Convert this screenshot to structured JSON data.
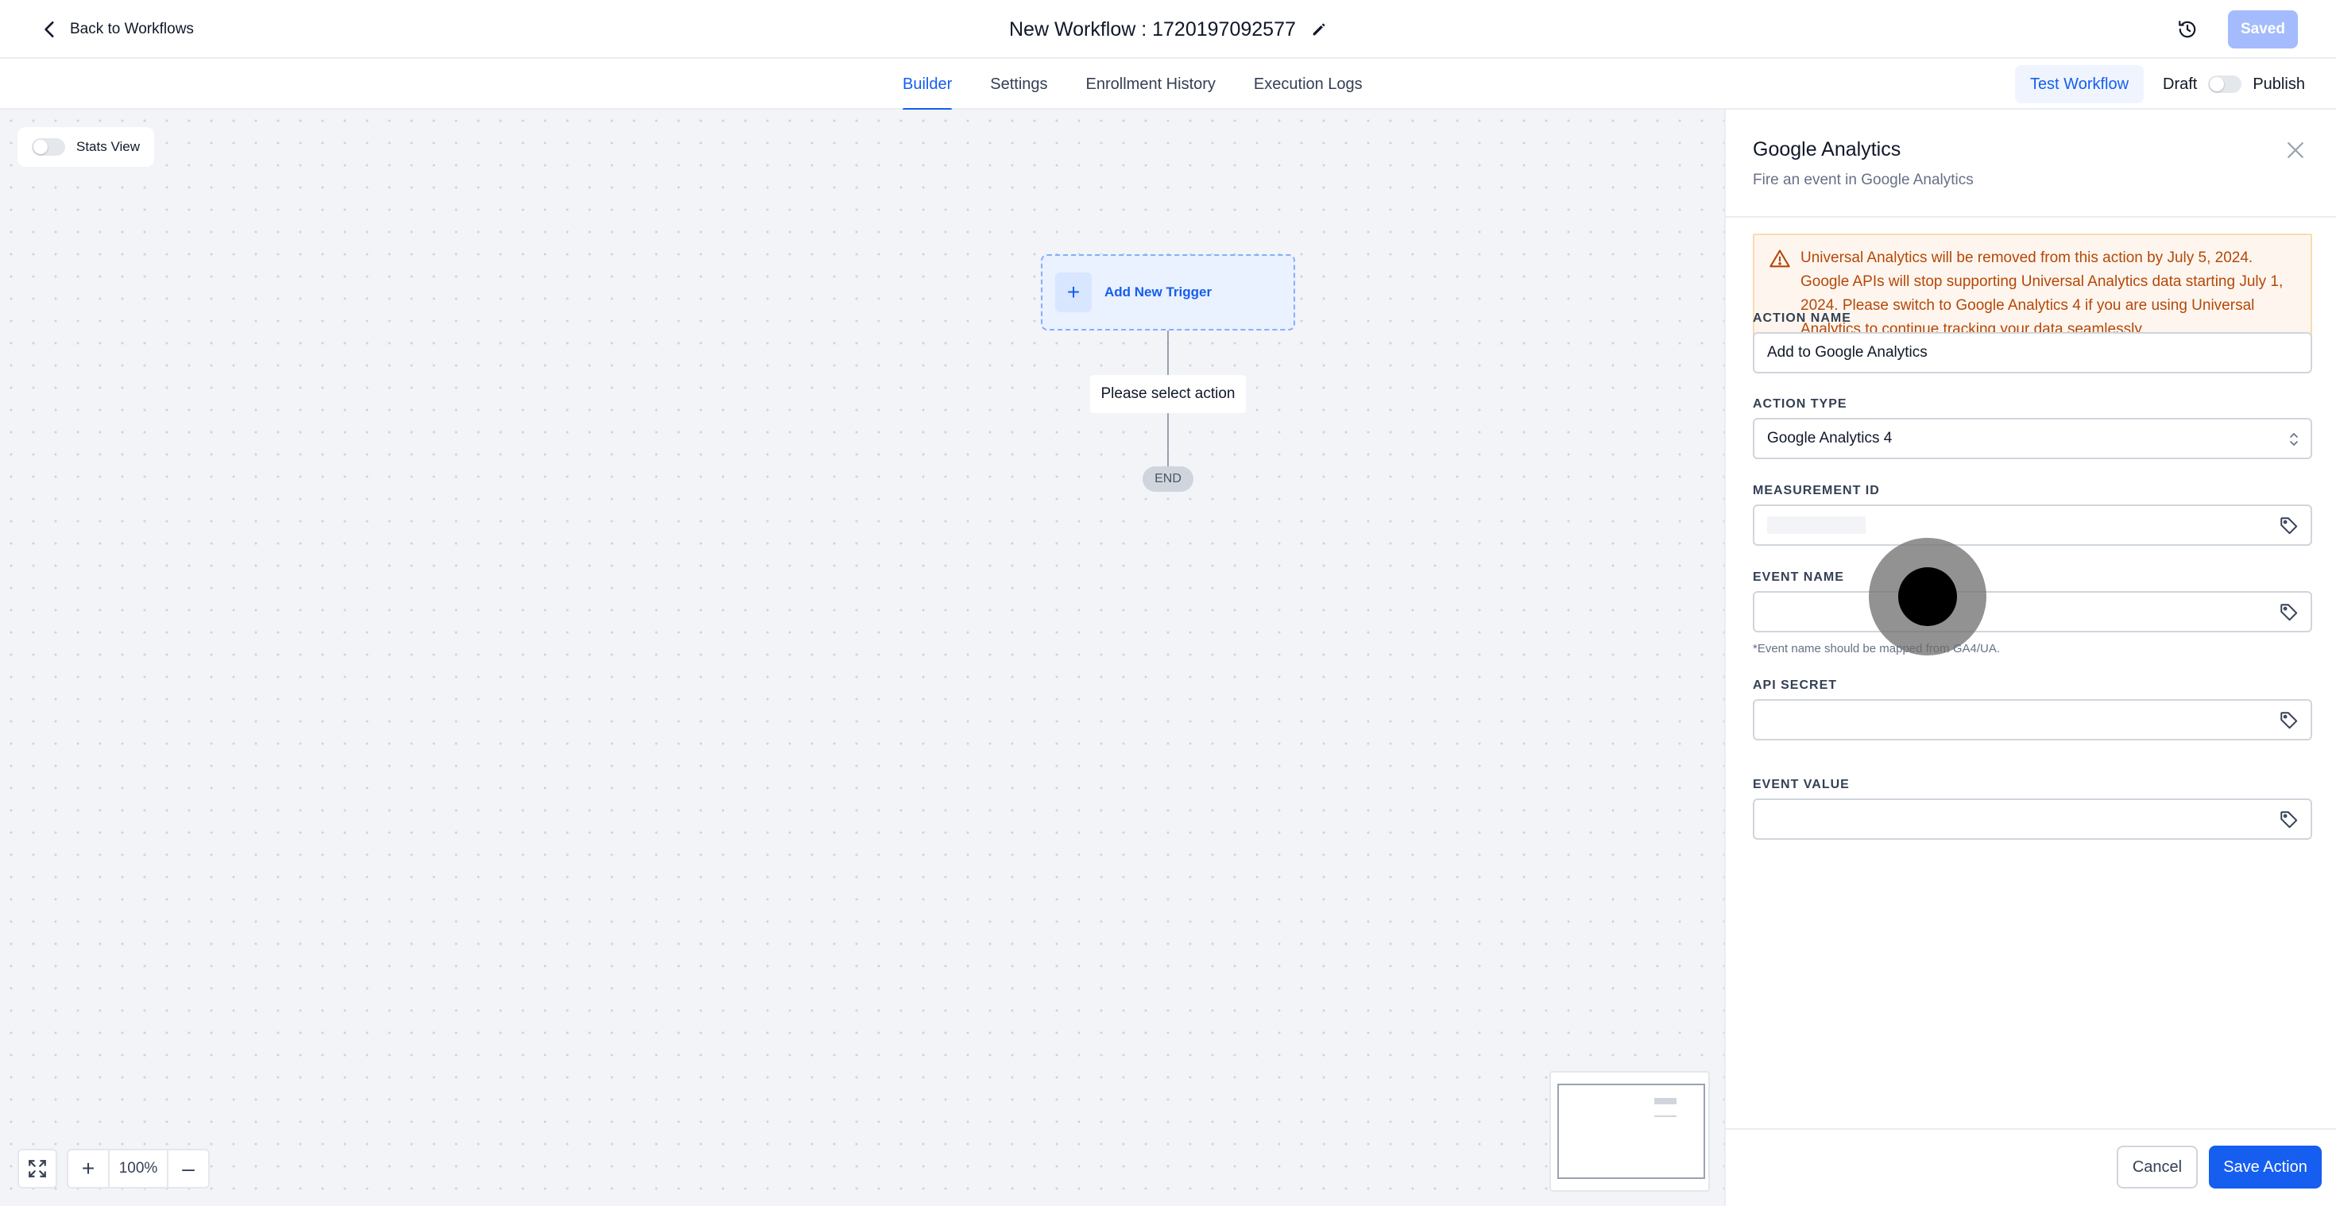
{
  "header": {
    "back_label": "Back to Workflows",
    "workflow_title": "New Workflow : 1720197092577",
    "saved_label": "Saved"
  },
  "tabs": [
    {
      "label": "Builder",
      "active": true
    },
    {
      "label": "Settings",
      "active": false
    },
    {
      "label": "Enrollment History",
      "active": false
    },
    {
      "label": "Execution Logs",
      "active": false
    }
  ],
  "toolbar": {
    "test_label": "Test Workflow",
    "draft_label": "Draft",
    "publish_label": "Publish",
    "publish_on": false
  },
  "canvas": {
    "stats_view_label": "Stats View",
    "stats_view_on": false,
    "trigger_label": "Add New Trigger",
    "select_action_label": "Please select action",
    "end_label": "END",
    "zoom_label": "100%",
    "zoom_in_symbol": "+",
    "zoom_out_symbol": "–"
  },
  "panel": {
    "title": "Google Analytics",
    "subtitle": "Fire an event in Google Analytics",
    "warning": "Universal Analytics will be removed from this action by July 5, 2024. Google APIs will stop supporting Universal Analytics data starting July 1, 2024. Please switch to Google Analytics 4 if you are using Universal Analytics to continue tracking your data seamlessly.",
    "fields": {
      "action_name": {
        "label": "ACTION NAME",
        "value": "Add to Google Analytics"
      },
      "action_type": {
        "label": "ACTION TYPE",
        "value": "Google Analytics 4"
      },
      "measurement_id": {
        "label": "MEASUREMENT ID",
        "value": ""
      },
      "event_name": {
        "label": "EVENT NAME",
        "value": "",
        "hint": "*Event name should be mapped from GA4/UA."
      },
      "api_secret": {
        "label": "API SECRET",
        "value": ""
      },
      "event_value": {
        "label": "EVENT VALUE",
        "value": ""
      }
    },
    "cancel_label": "Cancel",
    "save_label": "Save Action"
  },
  "colors": {
    "primary": "#155eef",
    "warning_text": "#b54708",
    "warning_bg": "#fef6ee",
    "canvas_bg": "#f2f4f7"
  }
}
